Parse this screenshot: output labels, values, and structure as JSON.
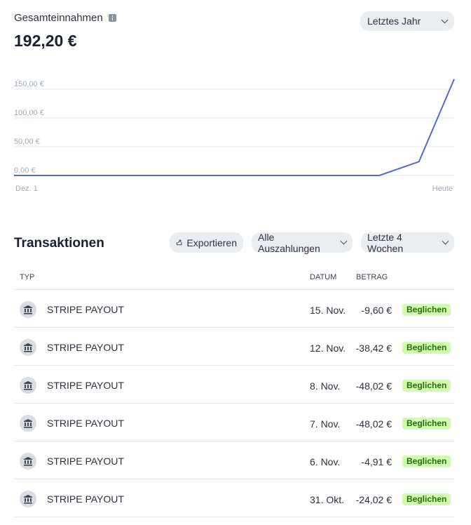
{
  "header": {
    "title": "Gesamteinnahmen",
    "total": "192,20 €",
    "period_selected": "Letztes Jahr"
  },
  "chart_data": {
    "type": "line",
    "yticks": [
      "150,00 €",
      "100,00 €",
      "50,00 €",
      "0,00 €"
    ],
    "ytick_values": [
      150,
      100,
      50,
      0
    ],
    "ylim": [
      0,
      150
    ],
    "xtick_start": "Dez. 1",
    "xtick_end": "Heute",
    "grid": true,
    "series": [
      {
        "color": "#5469d4",
        "x": [
          0,
          0.83,
          0.92,
          1.0
        ],
        "values": [
          0,
          0,
          24.02,
          167.5
        ]
      }
    ]
  },
  "transactions": {
    "title": "Transaktionen",
    "export_label": "Exportieren",
    "filter_payouts": "Alle Auszahlungen",
    "filter_period": "Letzte 4 Wochen",
    "columns": {
      "type": "TYP",
      "date": "DATUM",
      "amount": "BETRAG"
    },
    "rows": [
      {
        "type": "STRIPE PAYOUT",
        "date": "15. Nov.",
        "amount": "-9,60 €",
        "status": "Beglichen"
      },
      {
        "type": "STRIPE PAYOUT",
        "date": "12. Nov.",
        "amount": "-38,42 €",
        "status": "Beglichen"
      },
      {
        "type": "STRIPE PAYOUT",
        "date": "8. Nov.",
        "amount": "-48,02 €",
        "status": "Beglichen"
      },
      {
        "type": "STRIPE PAYOUT",
        "date": "7. Nov.",
        "amount": "-48,02 €",
        "status": "Beglichen"
      },
      {
        "type": "STRIPE PAYOUT",
        "date": "6. Nov.",
        "amount": "-4,91 €",
        "status": "Beglichen"
      },
      {
        "type": "STRIPE PAYOUT",
        "date": "31. Okt.",
        "amount": "-24,02 €",
        "status": "Beglichen"
      }
    ]
  },
  "icons": {
    "info": "info-icon",
    "export": "export-icon",
    "bank": "bank-icon",
    "chevron": "chevron-down-icon"
  },
  "colors": {
    "line": "#5469d4",
    "badge_bg": "#d1fab3",
    "badge_text": "#217005"
  }
}
